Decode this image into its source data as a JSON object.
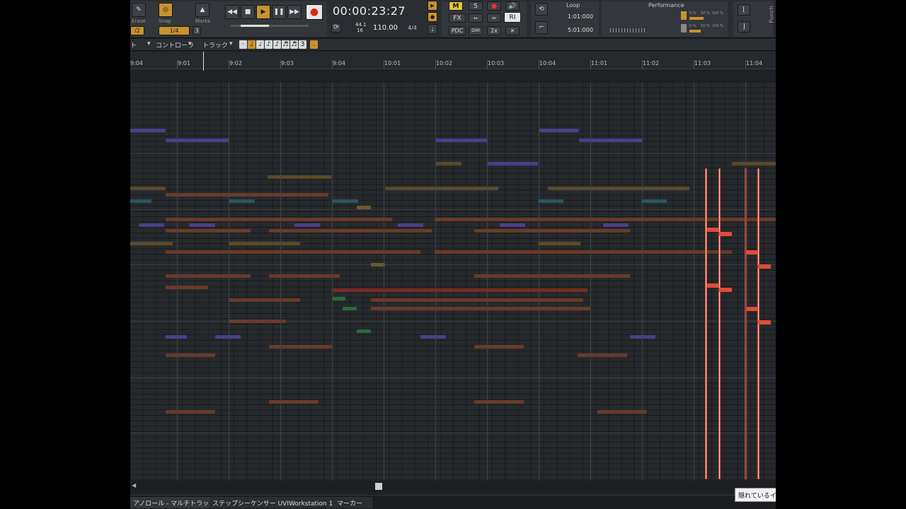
{
  "control_bar": {
    "erase_label": "Erase",
    "snap_label": "Snap",
    "marks_label": "Marks",
    "snap_value": "1/4",
    "triplet_value": "3",
    "frac_left": "/2",
    "time_display": "00:00:23:27",
    "sample_rate": "44.1",
    "bit_depth": "16",
    "tempo": "110.00",
    "meter": "4/4",
    "mix_m": "M",
    "mix_s": "S",
    "fx": "FX",
    "pdc": "PDC",
    "dim": "DIM",
    "two_x": "2x",
    "ri": "RI",
    "loop_label": "Loop",
    "loop_start": "1:01:000",
    "loop_end": "5:01:000",
    "performance_label": "Performance",
    "punch_label": "Punch",
    "perf_pct_a1": "0 %",
    "perf_pct_a2": "50 %",
    "perf_pct_a3": "100 %",
    "perf_pct_b1": "0 %",
    "perf_pct_b2": "50 %",
    "perf_pct_b3": "100 %"
  },
  "toolbar": {
    "edit_menu": "ト",
    "controller_menu": "コントローラ",
    "track_menu": "トラック",
    "triplet": "3"
  },
  "ruler": {
    "ticks": [
      "9:04",
      "9:01",
      "9:02",
      "9:03",
      "9:04",
      "10:01",
      "10:02",
      "10:03",
      "10:04",
      "11:01",
      "11:02",
      "11:03",
      "11:04"
    ]
  },
  "tabs": [
    {
      "label": "アノロール - マルチトラック"
    },
    {
      "label": "ステップシーケンサー UVIWorkstation 1"
    },
    {
      "label": "マーカー"
    }
  ],
  "tooltip": "隠れているインス",
  "colors": {
    "accent_gold": "#c8922e",
    "highlight_note": "#e24b35",
    "background": "#272a2d"
  }
}
